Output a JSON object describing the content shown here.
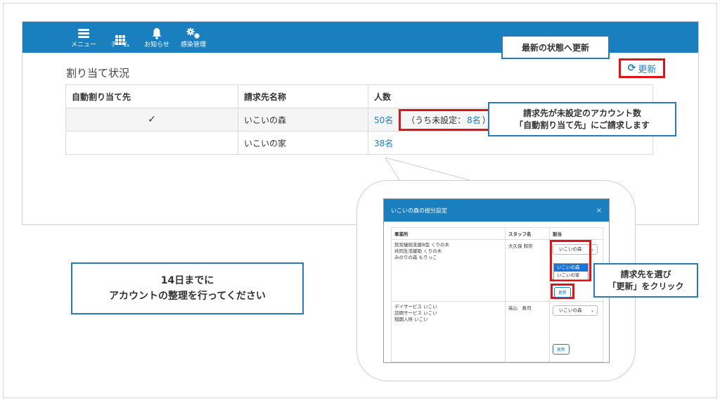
{
  "nav": {
    "items": [
      {
        "label": "メニュー",
        "icon": "hamburger-icon"
      },
      {
        "label": "チーム",
        "icon": "grid-icon"
      },
      {
        "label": "お知らせ",
        "icon": "bell-icon"
      },
      {
        "label": "感染管理",
        "icon": "gears-icon"
      }
    ]
  },
  "page": {
    "title": "割り当て状況",
    "refresh_icon": "⟳",
    "refresh_label": "更新"
  },
  "table": {
    "headers": [
      "自動割り当て先",
      "請求先名称",
      "人数"
    ],
    "rows": [
      {
        "auto": "✓",
        "name": "いこいの森",
        "count": "50名",
        "unset_prefix": "（うち未設定：",
        "unset_count": "8名",
        "unset_suffix": "）"
      },
      {
        "auto": "",
        "name": "いこいの家",
        "count": "38名"
      }
    ]
  },
  "callouts": {
    "refresh_note": "最新の状態へ更新",
    "unset_note_1": "請求先が未設定のアカウント数",
    "unset_note_2": "「自動割り当て先」にご請求します",
    "deadline_1": "14日までに",
    "deadline_2": "アカウントの整理を行ってください",
    "select_note_1": "請求先を選び",
    "select_note_2": "「更新」をクリック"
  },
  "modal": {
    "title": "いこいの森の按分設定",
    "close": "×",
    "headers": [
      "事業所",
      "スタッフ名",
      "割当"
    ],
    "rows": [
      {
        "offices": [
          "就労継続支援B型 くりの木",
          "共同生活援助 くりの木",
          "みのりの森 もりっこ"
        ],
        "staff": "大久保 和奈",
        "select": "いこいの森",
        "options": [
          "いこいの森",
          "いこいの家"
        ],
        "button": "更新"
      },
      {
        "offices": [
          "デイサービス いこい",
          "訪問サービス いこい",
          "短期入所 いこい"
        ],
        "staff": "高山　真司",
        "select": "いこいの森",
        "button": "更新"
      }
    ]
  },
  "colors": {
    "brand_blue": "#1a7fbf",
    "highlight_red": "#e0131b",
    "callout_border": "#2a7ab8"
  }
}
